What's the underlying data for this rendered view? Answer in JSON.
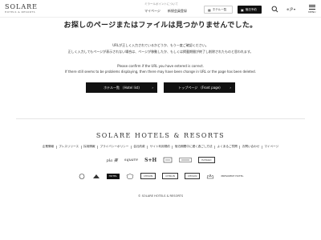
{
  "header": {
    "logo_main": "SOLARE",
    "logo_sub": "HOTELS & RESORTS",
    "promo": "ミラールポイントについて",
    "mypage": "マイページ",
    "register": "新規会員登録",
    "hotel_list": "ホテル一覧",
    "reserve": "宿泊予約",
    "lang": "JP",
    "menu_label": "MENU"
  },
  "main": {
    "title": "お探しのページまたはファイルは見つかりませんでした。",
    "jp_line1": "URLが正しく入力されているかどうか、もう一度ご確認ください。",
    "jp_line2": "正しく入力してもページが表示されない場合は、ページが移動したか、もしくは掲載期間が終了し削除されたものと思われます。",
    "en_line1": "Please confirm if the URL you have entered is correct.",
    "en_line2": "If there still seems to be problems displaying, then there may have been change in URL or the page has been deleted.",
    "btn_hotels": "ホテル一覧　(Hotel list)",
    "btn_top": "トップページ　(Front page)"
  },
  "footer": {
    "logo": "SOLARE HOTELS & RESORTS",
    "links": [
      "企業情報",
      "プレスリリース",
      "採用情報",
      "プライバシーポリシー",
      "会社約款",
      "サイト利用規約",
      "宿泊期間中に遅く過ごし方法",
      "よくあるご質問",
      "お問い合わせ",
      "マイページ"
    ],
    "brands_row1": [
      "pla 楽",
      "square",
      "S+H",
      "",
      "",
      "HATAGO"
    ],
    "brands_row2": [
      "CHISUN",
      "",
      "",
      "CHISUN",
      "CHISUN",
      "CHISUN",
      "",
      "PRESIDENT HOTEL"
    ],
    "copyright": "© SOLARE HOTELS & RESORTS"
  }
}
